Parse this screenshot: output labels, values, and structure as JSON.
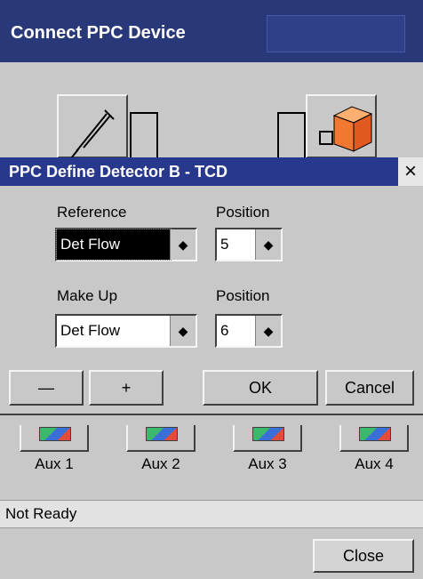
{
  "window": {
    "title": "Connect PPC Device"
  },
  "toolbar": {
    "left_icon": "syringe-icon",
    "right_icon": "device-cube-icon"
  },
  "aux": [
    {
      "label": "Aux 1"
    },
    {
      "label": "Aux 2"
    },
    {
      "label": "Aux 3"
    },
    {
      "label": "Aux 4"
    }
  ],
  "status": {
    "text": "Not Ready"
  },
  "close_label": "Close",
  "dialog": {
    "title": "PPC Define Detector B - TCD",
    "close_glyph": "×",
    "reference": {
      "label": "Reference",
      "value": "Det Flow"
    },
    "reference_position": {
      "label": "Position",
      "value": "5"
    },
    "makeup": {
      "label": "Make Up",
      "value": "Det Flow"
    },
    "makeup_position": {
      "label": "Position",
      "value": "6"
    },
    "spinner_glyph": "◆",
    "buttons": {
      "minus": "—",
      "plus": "+",
      "ok": "OK",
      "cancel": "Cancel"
    }
  },
  "colors": {
    "title_bar": "#283878",
    "dialog_title_bar": "#28388c",
    "window_bg": "#c8c8c8",
    "status_bg": "#e2e2e2"
  }
}
